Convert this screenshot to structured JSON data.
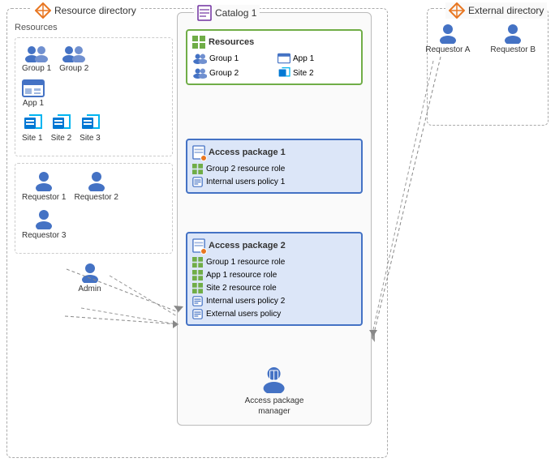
{
  "resourceDirectory": {
    "label": "Resource directory"
  },
  "externalDirectory": {
    "label": "External directory"
  },
  "resources": {
    "title": "Resources",
    "groups": [
      "Group 1",
      "Group 2"
    ],
    "apps": [
      "App 1"
    ],
    "sites": [
      "Site 1",
      "Site 2",
      "Site 3"
    ]
  },
  "catalog": {
    "label": "Catalog 1",
    "resources": {
      "title": "Resources",
      "items": [
        {
          "type": "group",
          "label": "Group 1"
        },
        {
          "type": "app",
          "label": "App 1"
        },
        {
          "type": "group",
          "label": "Group 2"
        },
        {
          "type": "site",
          "label": "Site 2"
        }
      ]
    }
  },
  "accessPackage1": {
    "label": "Access package 1",
    "items": [
      {
        "type": "resource-role",
        "label": "Group 2 resource role"
      },
      {
        "type": "policy",
        "label": "Internal users policy 1"
      }
    ]
  },
  "accessPackage2": {
    "label": "Access package 2",
    "items": [
      {
        "type": "resource-role",
        "label": "Group 1 resource role"
      },
      {
        "type": "resource-role",
        "label": "App 1 resource role"
      },
      {
        "type": "resource-role",
        "label": "Site 2 resource role"
      },
      {
        "type": "policy",
        "label": "Internal users policy 2"
      },
      {
        "type": "policy",
        "label": "External users policy"
      }
    ]
  },
  "requestorsInternal": [
    "Requestor 1",
    "Requestor 2",
    "Requestor 3"
  ],
  "requestorsExternal": [
    "Requestor A",
    "Requestor B"
  ],
  "admin": "Admin",
  "accessPackageManager": "Access package\nmanager"
}
